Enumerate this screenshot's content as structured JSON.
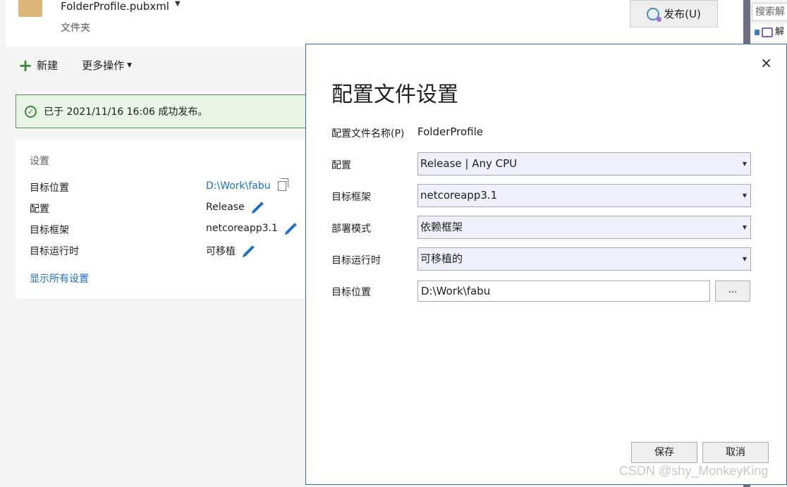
{
  "header": {
    "profile_name": "FolderProfile.pubxml",
    "profile_sub": "文件夹",
    "publish_label": "发布(U)"
  },
  "right_strip": {
    "search_placeholder": "搜索解",
    "row_label": "解"
  },
  "toolbar": {
    "new_label": "新建",
    "more_label": "更多操作"
  },
  "banner": {
    "text": "已于 2021/11/16 16:06 成功发布。"
  },
  "settings": {
    "title": "设置",
    "rows": [
      {
        "label": "目标位置",
        "value": "D:\\Work\\fabu"
      },
      {
        "label": "配置",
        "value": "Release"
      },
      {
        "label": "目标框架",
        "value": "netcoreapp3.1"
      },
      {
        "label": "目标运行时",
        "value": "可移植"
      }
    ],
    "show_all": "显示所有设置"
  },
  "dialog": {
    "title": "配置文件设置",
    "profile_name_label": "配置文件名称(P)",
    "profile_name_value": "FolderProfile",
    "fields": [
      {
        "label": "配置",
        "value": "Release | Any CPU"
      },
      {
        "label": "目标框架",
        "value": "netcoreapp3.1"
      },
      {
        "label": "部署模式",
        "value": "依赖框架"
      },
      {
        "label": "目标运行时",
        "value": "可移植的"
      }
    ],
    "location_label": "目标位置",
    "location_value": "D:\\Work\\fabu",
    "browse_label": "...",
    "save_label": "保存",
    "cancel_label": "取消",
    "close_glyph": "×"
  },
  "watermark": "CSDN @shy_MonkeyKing",
  "colors": {
    "accent": "#1a6fc4",
    "success": "#3b8a3b",
    "select_bg": "#eef1fb",
    "dialog_border": "#3c6aa8"
  }
}
